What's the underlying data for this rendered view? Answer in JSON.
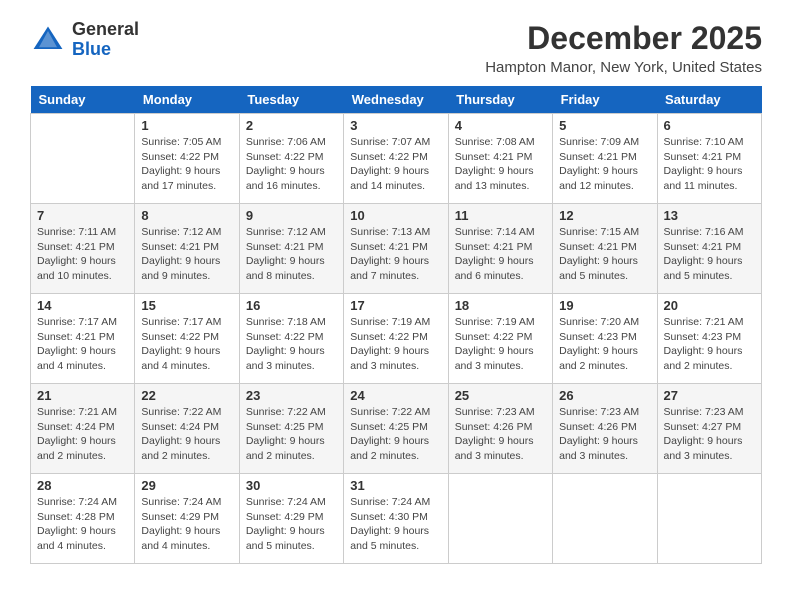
{
  "header": {
    "logo_line1": "General",
    "logo_line2": "Blue",
    "month_title": "December 2025",
    "location": "Hampton Manor, New York, United States"
  },
  "days_of_week": [
    "Sunday",
    "Monday",
    "Tuesday",
    "Wednesday",
    "Thursday",
    "Friday",
    "Saturday"
  ],
  "weeks": [
    [
      {
        "day": "",
        "info": ""
      },
      {
        "day": "1",
        "info": "Sunrise: 7:05 AM\nSunset: 4:22 PM\nDaylight: 9 hours\nand 17 minutes."
      },
      {
        "day": "2",
        "info": "Sunrise: 7:06 AM\nSunset: 4:22 PM\nDaylight: 9 hours\nand 16 minutes."
      },
      {
        "day": "3",
        "info": "Sunrise: 7:07 AM\nSunset: 4:22 PM\nDaylight: 9 hours\nand 14 minutes."
      },
      {
        "day": "4",
        "info": "Sunrise: 7:08 AM\nSunset: 4:21 PM\nDaylight: 9 hours\nand 13 minutes."
      },
      {
        "day": "5",
        "info": "Sunrise: 7:09 AM\nSunset: 4:21 PM\nDaylight: 9 hours\nand 12 minutes."
      },
      {
        "day": "6",
        "info": "Sunrise: 7:10 AM\nSunset: 4:21 PM\nDaylight: 9 hours\nand 11 minutes."
      }
    ],
    [
      {
        "day": "7",
        "info": "Sunrise: 7:11 AM\nSunset: 4:21 PM\nDaylight: 9 hours\nand 10 minutes."
      },
      {
        "day": "8",
        "info": "Sunrise: 7:12 AM\nSunset: 4:21 PM\nDaylight: 9 hours\nand 9 minutes."
      },
      {
        "day": "9",
        "info": "Sunrise: 7:12 AM\nSunset: 4:21 PM\nDaylight: 9 hours\nand 8 minutes."
      },
      {
        "day": "10",
        "info": "Sunrise: 7:13 AM\nSunset: 4:21 PM\nDaylight: 9 hours\nand 7 minutes."
      },
      {
        "day": "11",
        "info": "Sunrise: 7:14 AM\nSunset: 4:21 PM\nDaylight: 9 hours\nand 6 minutes."
      },
      {
        "day": "12",
        "info": "Sunrise: 7:15 AM\nSunset: 4:21 PM\nDaylight: 9 hours\nand 5 minutes."
      },
      {
        "day": "13",
        "info": "Sunrise: 7:16 AM\nSunset: 4:21 PM\nDaylight: 9 hours\nand 5 minutes."
      }
    ],
    [
      {
        "day": "14",
        "info": "Sunrise: 7:17 AM\nSunset: 4:21 PM\nDaylight: 9 hours\nand 4 minutes."
      },
      {
        "day": "15",
        "info": "Sunrise: 7:17 AM\nSunset: 4:22 PM\nDaylight: 9 hours\nand 4 minutes."
      },
      {
        "day": "16",
        "info": "Sunrise: 7:18 AM\nSunset: 4:22 PM\nDaylight: 9 hours\nand 3 minutes."
      },
      {
        "day": "17",
        "info": "Sunrise: 7:19 AM\nSunset: 4:22 PM\nDaylight: 9 hours\nand 3 minutes."
      },
      {
        "day": "18",
        "info": "Sunrise: 7:19 AM\nSunset: 4:22 PM\nDaylight: 9 hours\nand 3 minutes."
      },
      {
        "day": "19",
        "info": "Sunrise: 7:20 AM\nSunset: 4:23 PM\nDaylight: 9 hours\nand 2 minutes."
      },
      {
        "day": "20",
        "info": "Sunrise: 7:21 AM\nSunset: 4:23 PM\nDaylight: 9 hours\nand 2 minutes."
      }
    ],
    [
      {
        "day": "21",
        "info": "Sunrise: 7:21 AM\nSunset: 4:24 PM\nDaylight: 9 hours\nand 2 minutes."
      },
      {
        "day": "22",
        "info": "Sunrise: 7:22 AM\nSunset: 4:24 PM\nDaylight: 9 hours\nand 2 minutes."
      },
      {
        "day": "23",
        "info": "Sunrise: 7:22 AM\nSunset: 4:25 PM\nDaylight: 9 hours\nand 2 minutes."
      },
      {
        "day": "24",
        "info": "Sunrise: 7:22 AM\nSunset: 4:25 PM\nDaylight: 9 hours\nand 2 minutes."
      },
      {
        "day": "25",
        "info": "Sunrise: 7:23 AM\nSunset: 4:26 PM\nDaylight: 9 hours\nand 3 minutes."
      },
      {
        "day": "26",
        "info": "Sunrise: 7:23 AM\nSunset: 4:26 PM\nDaylight: 9 hours\nand 3 minutes."
      },
      {
        "day": "27",
        "info": "Sunrise: 7:23 AM\nSunset: 4:27 PM\nDaylight: 9 hours\nand 3 minutes."
      }
    ],
    [
      {
        "day": "28",
        "info": "Sunrise: 7:24 AM\nSunset: 4:28 PM\nDaylight: 9 hours\nand 4 minutes."
      },
      {
        "day": "29",
        "info": "Sunrise: 7:24 AM\nSunset: 4:29 PM\nDaylight: 9 hours\nand 4 minutes."
      },
      {
        "day": "30",
        "info": "Sunrise: 7:24 AM\nSunset: 4:29 PM\nDaylight: 9 hours\nand 5 minutes."
      },
      {
        "day": "31",
        "info": "Sunrise: 7:24 AM\nSunset: 4:30 PM\nDaylight: 9 hours\nand 5 minutes."
      },
      {
        "day": "",
        "info": ""
      },
      {
        "day": "",
        "info": ""
      },
      {
        "day": "",
        "info": ""
      }
    ]
  ]
}
